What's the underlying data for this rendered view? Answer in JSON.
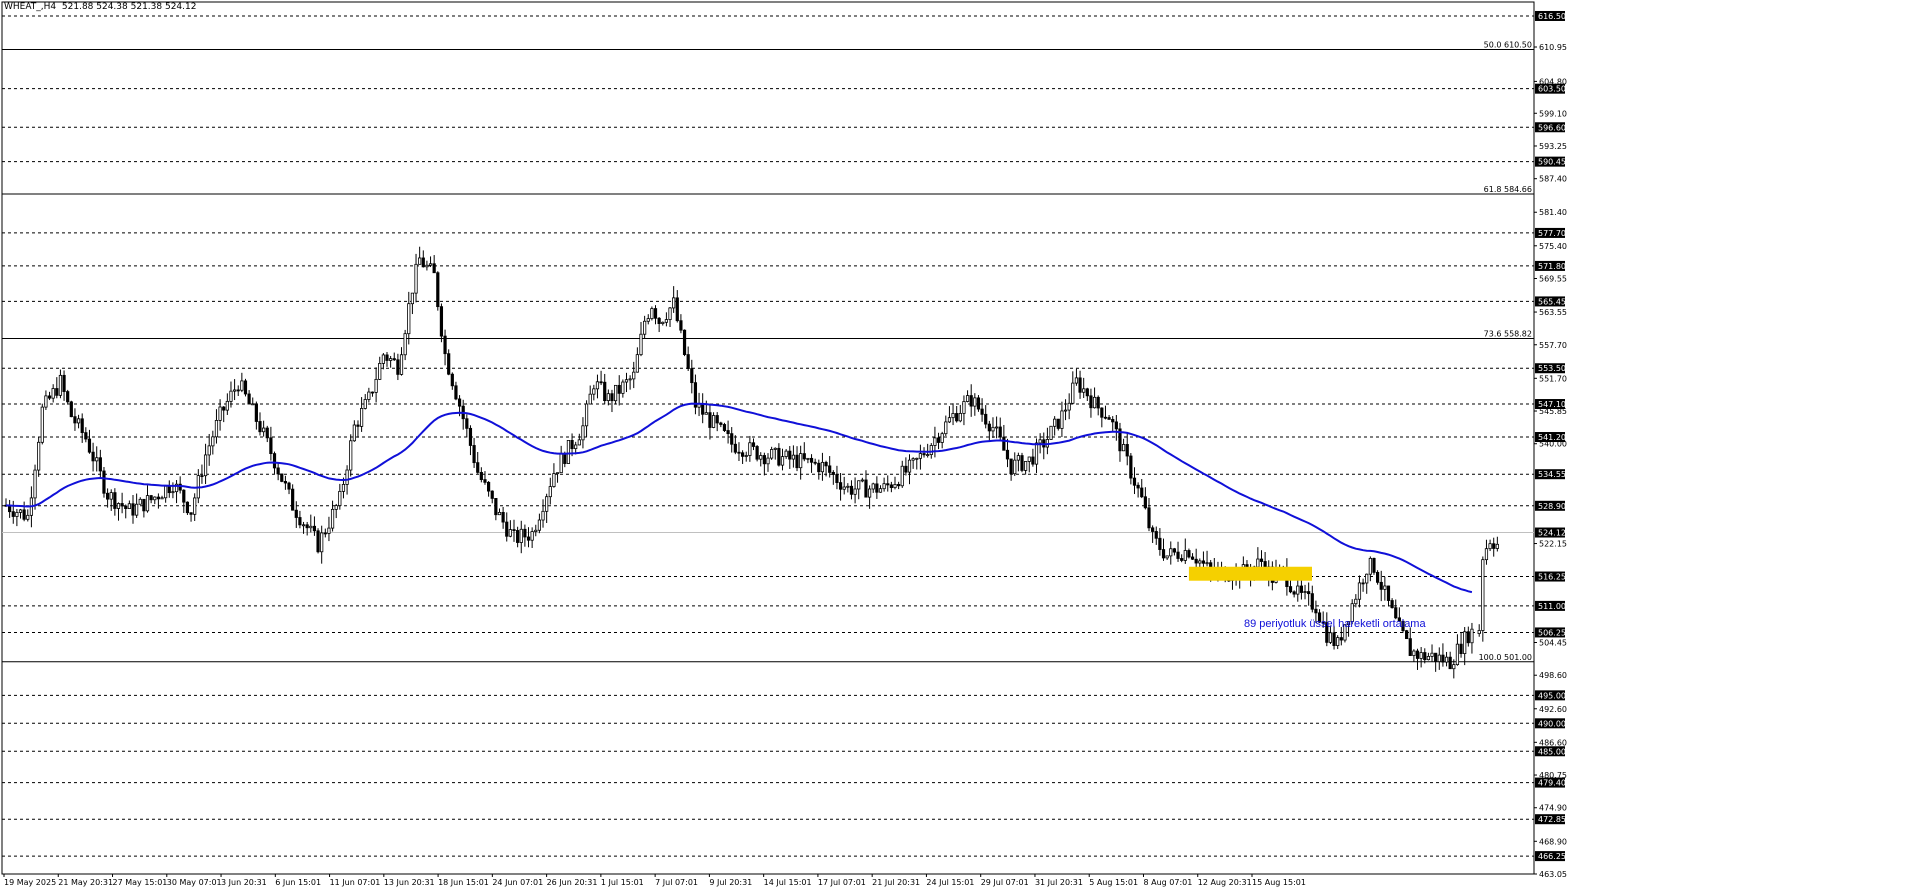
{
  "header": {
    "symbol": "WHEAT_,H4",
    "ohlc": "521.88 524.38 521.38 524.12"
  },
  "colors": {
    "background": "#ffffff",
    "candle": "#000000",
    "ema": "#1010d8",
    "zone": "#f5d000",
    "level_line": "#000000",
    "annotation": "#1010d8",
    "current_price_line": "#c0c0c0"
  },
  "chart_data": {
    "type": "candlestick",
    "symbol": "WHEAT",
    "timeframe": "H4",
    "ylim": [
      463.05,
      619.0
    ],
    "y_ticks": [
      "610.95",
      "604.80",
      "599.10",
      "593.25",
      "587.40",
      "581.40",
      "575.40",
      "569.55",
      "563.55",
      "557.70",
      "551.70",
      "545.85",
      "540.00",
      "522.15",
      "504.45",
      "498.60",
      "492.60",
      "486.60",
      "480.75",
      "474.90",
      "468.90",
      "463.05"
    ],
    "x_labels": [
      "19 May 2025",
      "21 May 20:31",
      "27 May 15:01",
      "30 May 07:01",
      "3 Jun 20:31",
      "6 Jun 15:01",
      "11 Jun 07:01",
      "13 Jun 20:31",
      "18 Jun 15:01",
      "24 Jun 07:01",
      "26 Jun 20:31",
      "1 Jul 15:01",
      "7 Jul 07:01",
      "9 Jul 20:31",
      "14 Jul 15:01",
      "17 Jul 07:01",
      "21 Jul 20:31",
      "24 Jul 15:01",
      "29 Jul 07:01",
      "31 Jul 20:31",
      "5 Aug 15:01",
      "8 Aug 07:01",
      "12 Aug 20:31",
      "15 Aug 15:01"
    ],
    "dashed_levels": [
      616.5,
      603.5,
      596.6,
      590.45,
      577.7,
      571.8,
      565.45,
      553.5,
      547.1,
      541.2,
      534.55,
      528.9,
      516.25,
      511.0,
      506.25,
      495.0,
      490.0,
      485.0,
      479.4,
      472.85,
      466.25
    ],
    "fibonacci_levels": [
      {
        "label": "50.0 610.50",
        "price": 610.5
      },
      {
        "label": "61.8 584.66",
        "price": 584.66
      },
      {
        "label": "73.6 558.82",
        "price": 558.82
      },
      {
        "label": "100.0 501.00",
        "price": 501.0
      }
    ],
    "current_price": 524.12,
    "current_price_label": "524.12",
    "support_zone": [
      515.5,
      518.0
    ],
    "ema_label": "89 periyotluk üssel hareketli ortalama",
    "ema_period": 89,
    "price_path": [
      [
        0,
        529
      ],
      [
        6,
        527
      ],
      [
        10,
        546
      ],
      [
        15,
        551
      ],
      [
        18,
        545
      ],
      [
        22,
        541
      ],
      [
        28,
        531
      ],
      [
        34,
        528
      ],
      [
        40,
        530
      ],
      [
        46,
        533
      ],
      [
        51,
        528
      ],
      [
        55,
        538
      ],
      [
        59,
        545
      ],
      [
        64,
        551
      ],
      [
        70,
        543
      ],
      [
        74,
        537
      ],
      [
        79,
        529
      ],
      [
        86,
        522
      ],
      [
        92,
        530
      ],
      [
        96,
        543
      ],
      [
        100,
        548
      ],
      [
        104,
        556
      ],
      [
        108,
        554
      ],
      [
        112,
        568
      ],
      [
        114,
        573
      ],
      [
        118,
        570
      ],
      [
        121,
        556
      ],
      [
        125,
        547
      ],
      [
        130,
        535
      ],
      [
        135,
        528
      ],
      [
        140,
        523
      ],
      [
        145,
        524
      ],
      [
        151,
        535
      ],
      [
        156,
        540
      ],
      [
        159,
        543
      ],
      [
        162,
        551
      ],
      [
        166,
        548
      ],
      [
        168,
        549
      ],
      [
        173,
        552
      ],
      [
        176,
        562
      ],
      [
        178,
        565
      ],
      [
        180,
        562
      ],
      [
        184,
        565
      ],
      [
        190,
        547
      ],
      [
        200,
        540
      ],
      [
        209,
        538
      ],
      [
        218,
        537
      ],
      [
        225,
        536
      ],
      [
        232,
        532
      ],
      [
        242,
        532
      ],
      [
        250,
        536
      ],
      [
        256,
        541
      ],
      [
        261,
        545
      ],
      [
        266,
        548
      ],
      [
        272,
        543
      ],
      [
        277,
        536
      ],
      [
        282,
        537
      ],
      [
        287,
        541
      ],
      [
        291,
        545
      ],
      [
        295,
        551
      ],
      [
        298,
        549
      ],
      [
        300,
        547
      ],
      [
        304,
        545
      ],
      [
        310,
        535
      ],
      [
        313,
        530
      ],
      [
        316,
        523
      ],
      [
        320,
        520
      ],
      [
        326,
        521
      ],
      [
        332,
        517
      ],
      [
        338,
        517
      ],
      [
        342,
        517
      ],
      [
        346,
        519
      ],
      [
        349,
        516
      ],
      [
        352,
        517
      ],
      [
        356,
        513
      ],
      [
        361,
        511
      ],
      [
        364,
        506
      ],
      [
        367,
        504
      ],
      [
        369,
        508
      ],
      [
        372,
        513
      ],
      [
        375,
        518
      ],
      [
        377,
        518
      ],
      [
        380,
        513
      ],
      [
        383,
        508
      ],
      [
        387,
        503
      ],
      [
        390,
        502
      ],
      [
        393,
        502
      ],
      [
        398,
        501
      ],
      [
        400,
        503
      ],
      [
        403,
        506
      ],
      [
        406,
        507
      ],
      [
        407,
        520
      ],
      [
        409,
        523
      ],
      [
        411,
        522
      ]
    ],
    "x_range": [
      0,
      420
    ]
  },
  "annotations": {
    "ema_text": "89 periyotluk üssel hareketli ortalama"
  }
}
